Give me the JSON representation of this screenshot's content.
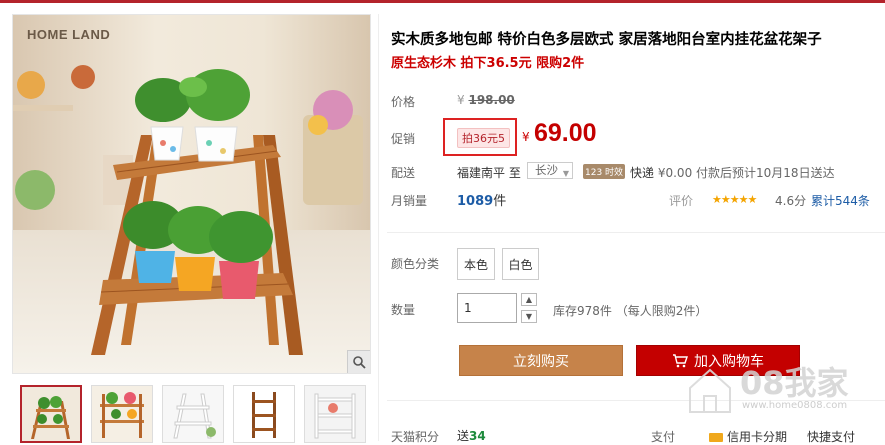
{
  "image": {
    "logo_text": "HOME LAND",
    "thumbnails": [
      "thumb-1",
      "thumb-2",
      "thumb-3",
      "thumb-4",
      "thumb-5"
    ]
  },
  "product": {
    "title": "实木质多地包邮 特价白色多层欧式 家居落地阳台室内挂花盆花架子",
    "subtitle": "原生态杉木 拍下36.5元 限购2件"
  },
  "price": {
    "label": "价格",
    "currency": "¥",
    "original": "198.00"
  },
  "promo": {
    "label": "促销",
    "tag": "拍36元5",
    "currency": "¥",
    "price": "69.00"
  },
  "delivery": {
    "label": "配送",
    "from": "福建南平",
    "to_word": "至",
    "city": "长沙",
    "badge": "123 时效",
    "method": "快递",
    "fee": "¥0.00",
    "note": "付款后预计10月18日送达"
  },
  "sales": {
    "label": "月销量",
    "count": "1089",
    "unit": "件",
    "review_label": "评价",
    "rating": "4.6分",
    "rating_value": 4.6,
    "review_link": "累计544条"
  },
  "options": {
    "label": "颜色分类",
    "values": [
      "本色",
      "白色"
    ]
  },
  "quantity": {
    "label": "数量",
    "value": "1",
    "stock": "库存978件 （每人限购2件）"
  },
  "actions": {
    "buy": "立刻购买",
    "cart": "加入购物车"
  },
  "footer": {
    "points_label": "天猫积分",
    "points_prefix": "送",
    "points": "34",
    "pay_label": "支付",
    "pay_credit": "信用卡分期",
    "pay_quick": "快捷支付"
  },
  "watermark": {
    "text": "08我家",
    "url": "www.home0808.com"
  },
  "colors": {
    "accent_red": "#c40000",
    "buy_button": "#c6834a",
    "topbar": "#b4232b"
  }
}
